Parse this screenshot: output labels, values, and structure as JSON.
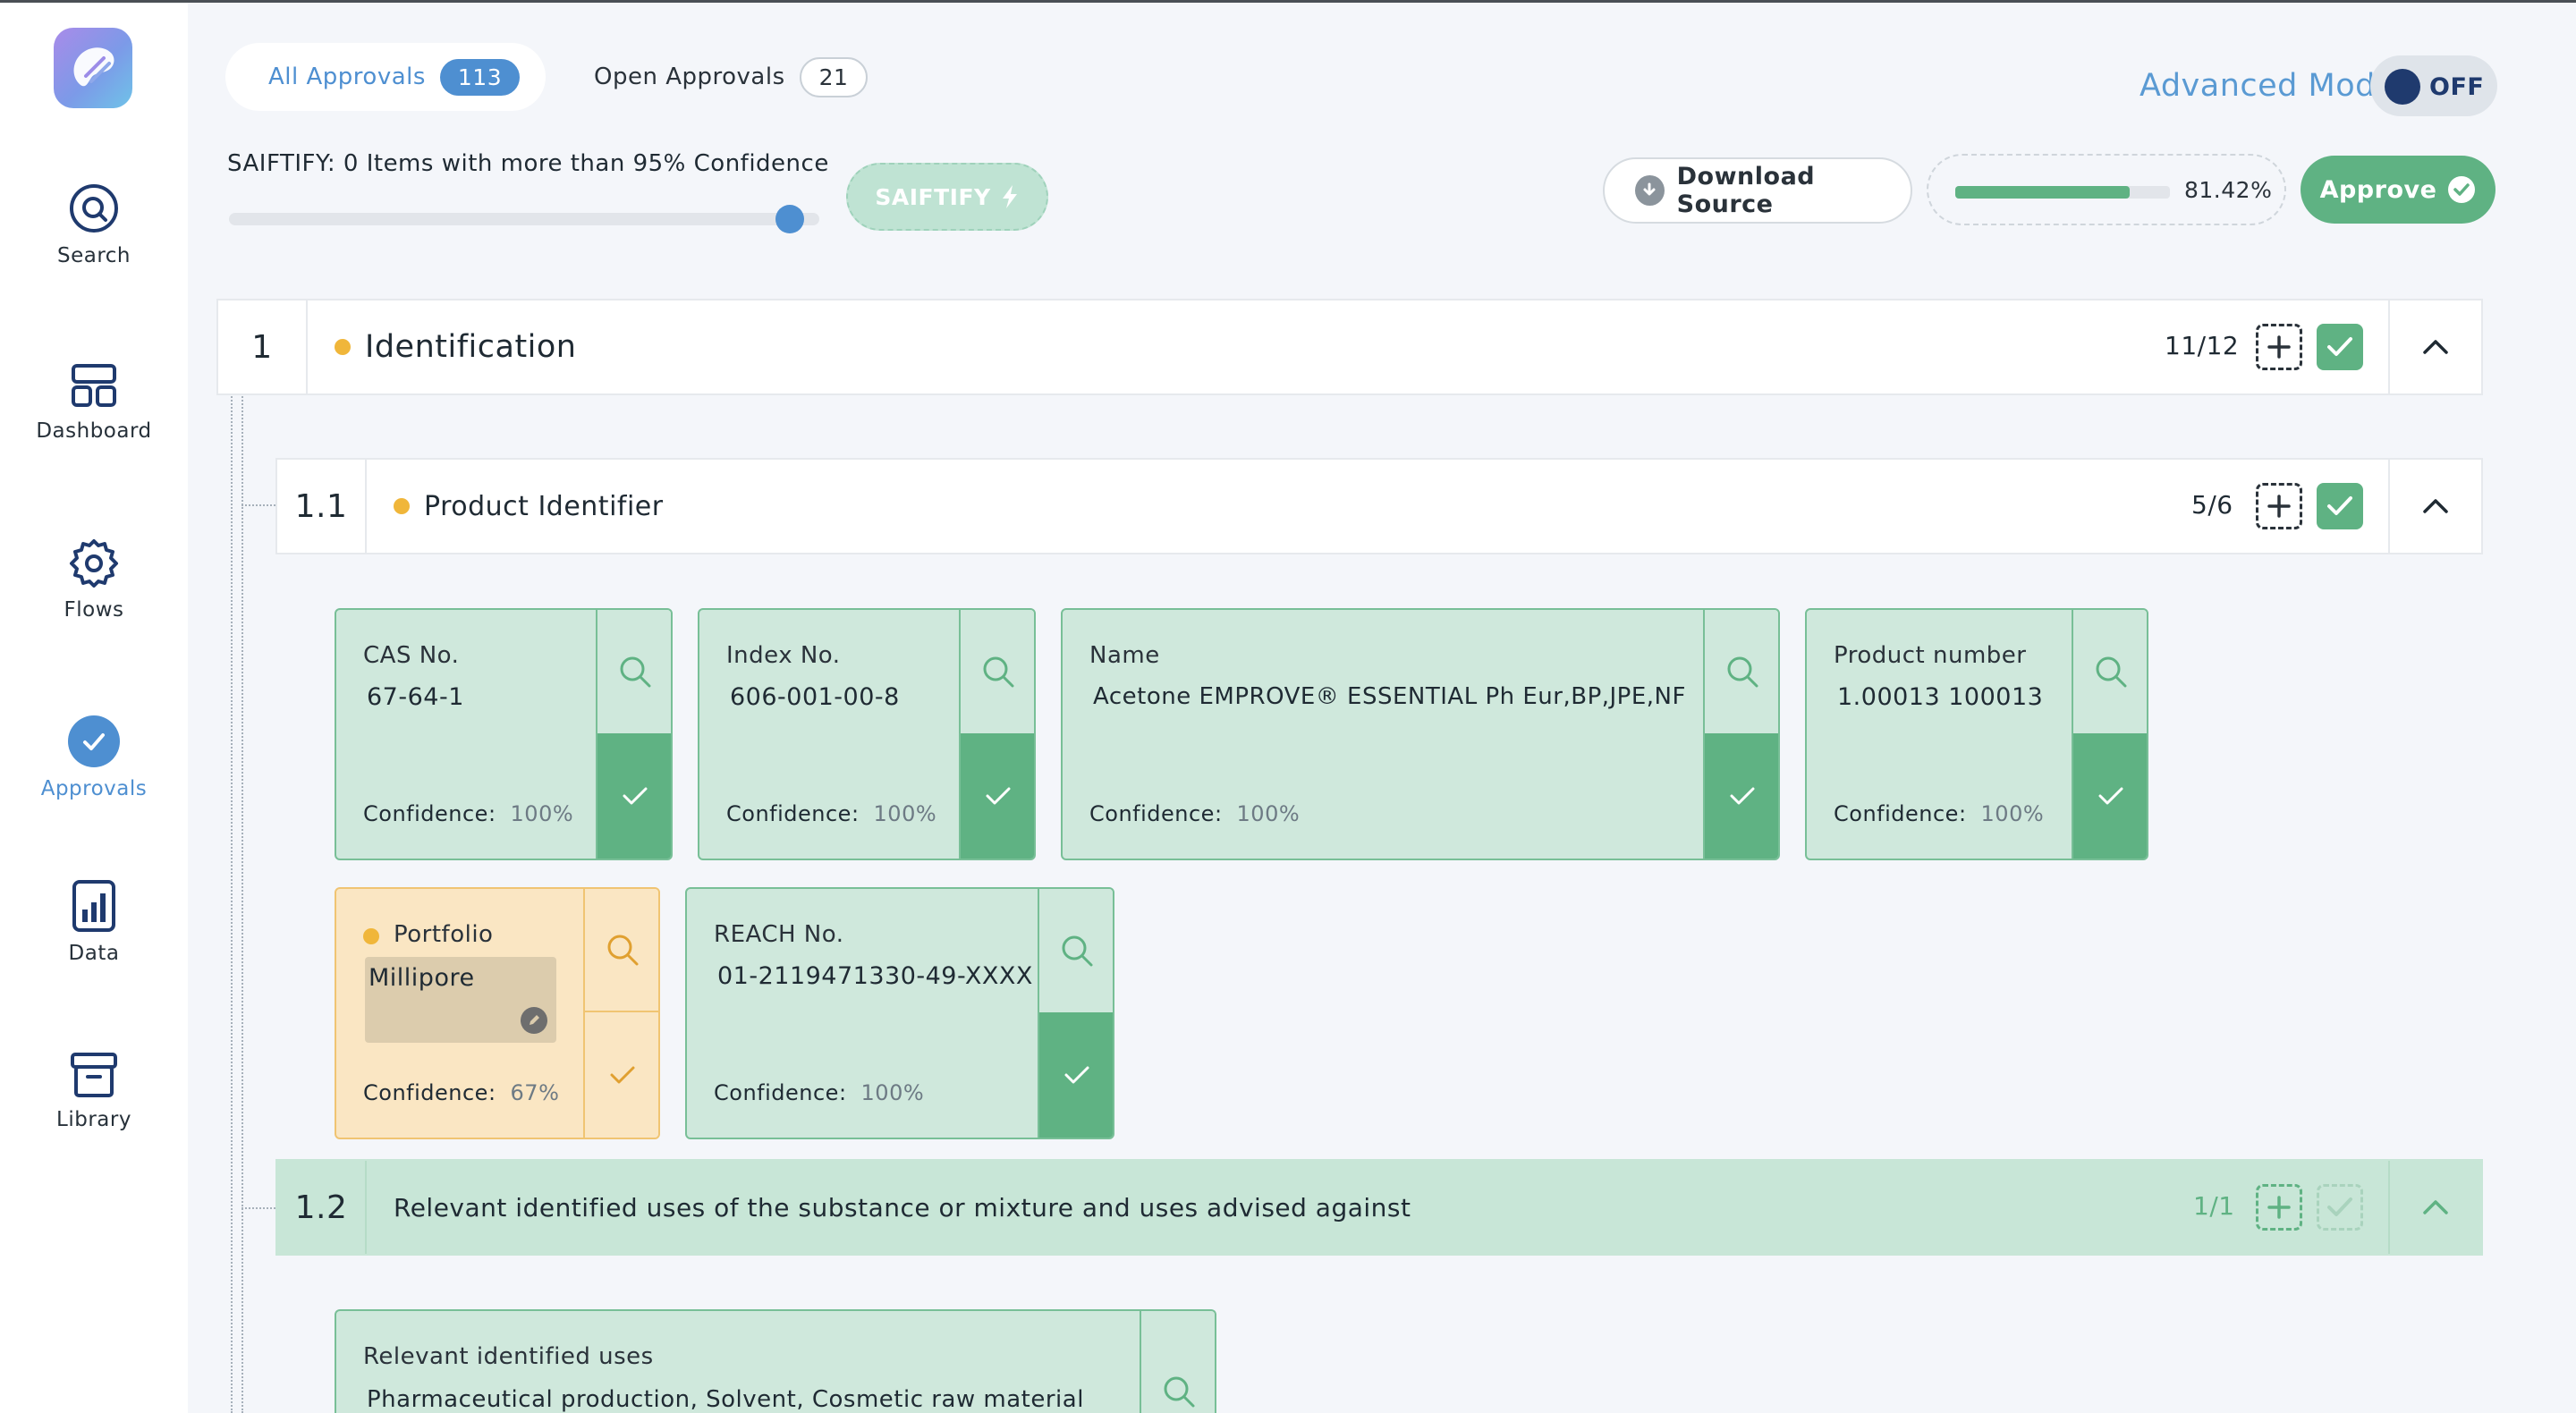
{
  "sidebar": {
    "items": [
      {
        "label": "Search",
        "icon": "search-icon"
      },
      {
        "label": "Dashboard",
        "icon": "dashboard-icon"
      },
      {
        "label": "Flows",
        "icon": "gear-icon"
      },
      {
        "label": "Approvals",
        "icon": "check-circle-icon",
        "active": true
      },
      {
        "label": "Data",
        "icon": "bar-chart-icon"
      },
      {
        "label": "Library",
        "icon": "archive-icon"
      }
    ]
  },
  "tabs": {
    "all_label": "All Approvals",
    "all_count": "113",
    "open_label": "Open Approvals",
    "open_count": "21"
  },
  "advanced_mode": {
    "label": "Advanced Mode",
    "state": "OFF"
  },
  "saiftify": {
    "label": "SAIFTIFY: 0 Items with more than 95% Confidence",
    "slider_value": 0.95,
    "button_label": "SAIFTIFY"
  },
  "actions": {
    "download_label": "Download Source",
    "progress_text": "81.42%",
    "progress_value": 0.8142,
    "approve_label": "Approve"
  },
  "sections": [
    {
      "number": "1",
      "title": "Identification",
      "count": "11/12"
    },
    {
      "number": "1.1",
      "title": "Product Identifier",
      "count": "5/6"
    },
    {
      "number": "1.2",
      "title": "Relevant identified uses of the substance or mixture and uses advised against",
      "count": "1/1"
    }
  ],
  "cards": [
    {
      "label": "CAS No.",
      "value": "67-64-1",
      "conf_label": "Confidence:",
      "confidence": "100%"
    },
    {
      "label": "Index No.",
      "value": "606-001-00-8",
      "conf_label": "Confidence:",
      "confidence": "100%"
    },
    {
      "label": "Name",
      "value": "Acetone EMPROVE® ESSENTIAL Ph  Eur,BP,JPE,NF",
      "conf_label": "Confidence:",
      "confidence": "100%"
    },
    {
      "label": "Product number",
      "value": "1.00013 100013",
      "conf_label": "Confidence:",
      "confidence": "100%"
    },
    {
      "label": "Portfolio",
      "value": "Millipore",
      "conf_label": "Confidence:",
      "confidence": "67%"
    },
    {
      "label": "REACH No.",
      "value": "01-2119471330-49-XXXX",
      "conf_label": "Confidence:",
      "confidence": "100%"
    },
    {
      "label": "Relevant identified uses",
      "value": "Pharmaceutical production, Solvent, Cosmetic raw material"
    }
  ],
  "colors": {
    "accent_blue": "#4e8fd1",
    "success_green": "#5fb283",
    "warning_orange": "#f0b63a"
  }
}
